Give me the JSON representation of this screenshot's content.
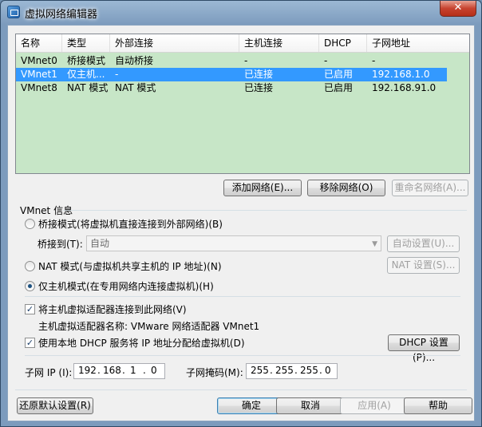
{
  "window": {
    "title": "虚拟网络编辑器",
    "close_glyph": "✕"
  },
  "list": {
    "columns": [
      "名称",
      "类型",
      "外部连接",
      "主机连接",
      "DHCP",
      "子网地址"
    ],
    "rows": [
      {
        "name": "VMnet0",
        "type": "桥接模式",
        "external": "自动桥接",
        "host": "-",
        "dhcp": "-",
        "subnet": "-"
      },
      {
        "name": "VMnet1",
        "type": "仅主机...",
        "external": "-",
        "host": "已连接",
        "dhcp": "已启用",
        "subnet": "192.168.1.0"
      },
      {
        "name": "VMnet8",
        "type": "NAT 模式",
        "external": "NAT 模式",
        "host": "已连接",
        "dhcp": "已启用",
        "subnet": "192.168.91.0"
      }
    ],
    "selected_row": "VMnet1"
  },
  "list_buttons": {
    "add": "添加网络(E)...",
    "remove": "移除网络(O)",
    "rename": "重命名网络(A)..."
  },
  "vmnet_info": {
    "group_title": "VMnet 信息",
    "bridged_label": "桥接模式(将虚拟机直接连接到外部网络)(B)",
    "bridge_to_label": "桥接到(T):",
    "bridge_to_value": "自动",
    "auto_settings": "自动设置(U)...",
    "nat_label": "NAT 模式(与虚拟机共享主机的 IP 地址)(N)",
    "nat_settings": "NAT 设置(S)...",
    "hostonly_label": "仅主机模式(在专用网络内连接虚拟机)(H)",
    "selected_mode": "hostonly",
    "connect_adapter_label": "将主机虚拟适配器连接到此网络(V)",
    "adapter_name_text": "主机虚拟适配器名称: VMware 网络适配器 VMnet1",
    "dhcp_label": "使用本地 DHCP 服务将 IP 地址分配给虚拟机(D)",
    "dhcp_settings": "DHCP 设置(P)...",
    "connect_adapter_checked": true,
    "dhcp_checked": true,
    "subnet_ip_label": "子网 IP (I):",
    "subnet_ip": [
      "192",
      "168",
      "1",
      "0"
    ],
    "subnet_mask_label": "子网掩码(M):",
    "subnet_mask": [
      "255",
      "255",
      "255",
      "0"
    ]
  },
  "footer": {
    "restore": "还原默认设置(R)",
    "ok": "确定",
    "cancel": "取消",
    "apply": "应用(A)",
    "help": "帮助"
  }
}
